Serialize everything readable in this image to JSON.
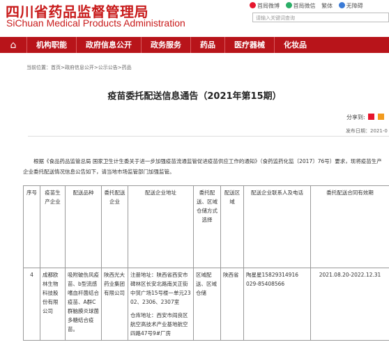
{
  "header": {
    "logo_cn": "四川省药品监督管理局",
    "logo_en": "SiChuan Medical Products Administration",
    "links": [
      "首局微博",
      "首局微信",
      "繁体",
      "无障碍"
    ],
    "search_placeholder": "请输入关键词查询"
  },
  "nav": {
    "items": [
      "机构职能",
      "政府信息公开",
      "政务服务",
      "药品",
      "医疗器械",
      "化妆品"
    ]
  },
  "breadcrumb": "当前位置：首页>政府信息公开>公示公告>药品",
  "article": {
    "title": "疫苗委托配送信息通告（2021年第15期）",
    "share_label": "分享到:",
    "publish_date": "发布日期：2021-0",
    "intro": "根据《食品药品监管总局 国家卫生计生委关于进一步加强疫苗流通监管促进疫苗供应工作的通知》（食药监药化监〔2017〕76号）要求，现将疫苗生产企业委托配送情况信息公告如下，请当地市场监管部门加强监管。"
  },
  "table": {
    "headers": [
      "序号",
      "疫苗生产企业",
      "配送品种",
      "委托配送企业",
      "配送企业地址",
      "委托配送、区域仓储方式选择",
      "配送区域",
      "配送企业联系人及电话",
      "委托配送合同有效期"
    ],
    "rows": [
      {
        "no": "4",
        "producer": "成都欧林生物科技股份有限公司",
        "varieties": "吸附破伤风疫苗、b型流感嗜血杆菌结合疫苗、A群C群脑膜炎球菌多糖结合疫苗。",
        "distributor": "陕西光大药业集团有限公司",
        "addr_reg": "注册地址：陕西省西安市碑林区长安北路南关正街中贸广场15号楼一单元2302、2306、2307室",
        "addr_wh": "仓库地址：西安市阎良区航空高技术产业基地航空四路47号9#厂房",
        "mode": "区域配送、区域仓储",
        "region": "陕西省",
        "contact_name": "陶星星15829314916",
        "contact_phone": "029-85408566",
        "validity": "2021.08.20-2022.12.31"
      }
    ]
  },
  "colors": {
    "brand_red": "#b8141a",
    "logo_red": "#c81a1a"
  }
}
